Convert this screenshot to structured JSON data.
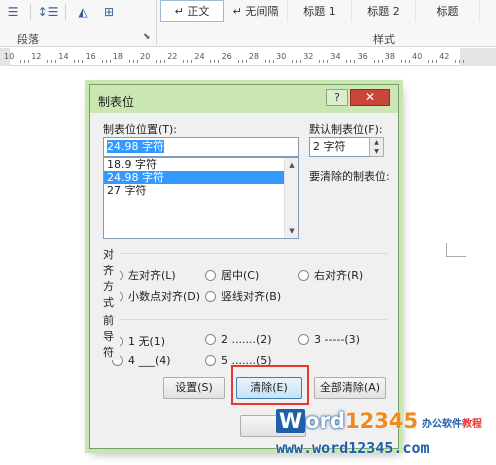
{
  "ribbon": {
    "icons": [
      "list-icon",
      "line-spacing-icon",
      "shading-icon",
      "borders-icon"
    ],
    "paragraph_group": "段落",
    "styles_group": "样式",
    "styles": [
      "↵ 正文",
      "↵ 无间隔",
      "标题 1",
      "标题 2",
      "标题"
    ]
  },
  "ruler": {
    "numbers": [
      "10",
      "12",
      "14",
      "16",
      "18",
      "20",
      "22",
      "24",
      "26",
      "28",
      "30",
      "32",
      "34",
      "36",
      "38",
      "40",
      "42"
    ]
  },
  "dialog": {
    "title": "制表位",
    "help": "?",
    "close": "✕",
    "tab_position_label": "制表位位置(T):",
    "tab_position_value": "24.98 字符",
    "tab_list": [
      "18.9 字符",
      "24.98 字符",
      "27 字符"
    ],
    "tab_list_selected_index": 1,
    "default_tab_label": "默认制表位(F):",
    "default_tab_value": "2 字符",
    "to_clear_label": "要清除的制表位:",
    "alignment_group": "对齐方式",
    "alignment": [
      {
        "label": "左对齐(L)",
        "checked": true
      },
      {
        "label": "居中(C)",
        "checked": false
      },
      {
        "label": "右对齐(R)",
        "checked": false
      },
      {
        "label": "小数点对齐(D)",
        "checked": false
      },
      {
        "label": "竖线对齐(B)",
        "checked": false
      }
    ],
    "leader_group": "前导符",
    "leader": [
      {
        "label": "1 无(1)",
        "checked": true
      },
      {
        "label": "2 .......(2)",
        "checked": false
      },
      {
        "label": "3 -----(3)",
        "checked": false
      },
      {
        "label": "4 ___(4)",
        "checked": false
      },
      {
        "label": "5 .......(5)",
        "checked": false
      }
    ],
    "buttons": {
      "set": "设置(S)",
      "clear": "清除(E)",
      "clear_all": "全部清除(A)"
    }
  },
  "watermark": {
    "logo_prefix": "W",
    "logo_text": "ord",
    "logo_num": "12345",
    "tag": "办公软件",
    "tag_red": "教程",
    "url": "www.word12345.com"
  }
}
